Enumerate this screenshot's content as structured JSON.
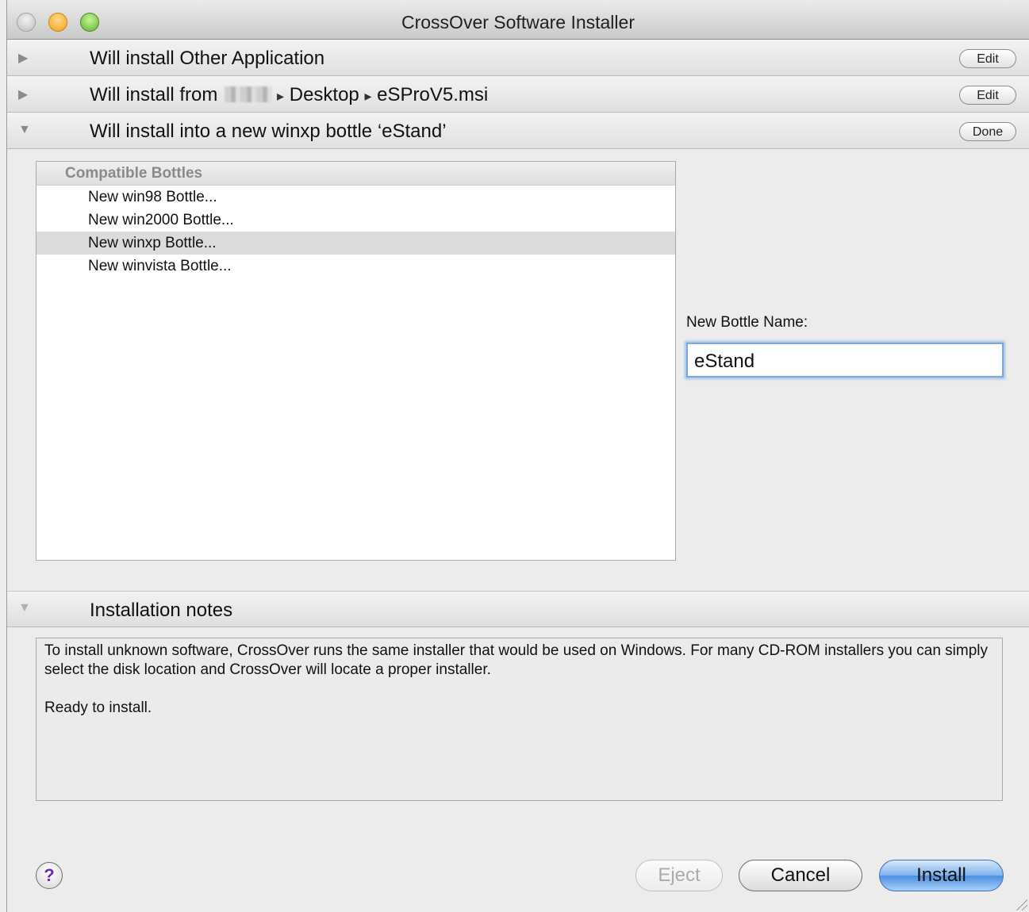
{
  "window": {
    "title": "CrossOver Software Installer"
  },
  "sections": [
    {
      "label": "Will install Other Application",
      "button": "Edit",
      "expanded": false
    },
    {
      "label_prefix": "Will install from",
      "path": [
        "Desktop",
        "eSProV5.msi"
      ],
      "path_separator": "▸",
      "button": "Edit",
      "expanded": false
    },
    {
      "label": "Will install into a new winxp bottle ‘eStand’",
      "button": "Done",
      "expanded": true
    }
  ],
  "bottles": {
    "header": "Compatible Bottles",
    "items": [
      "New win98 Bottle...",
      "New win2000 Bottle...",
      "New winxp Bottle...",
      "New winvista Bottle..."
    ],
    "selected": "New winxp Bottle..."
  },
  "new_bottle": {
    "label": "New Bottle Name:",
    "value": "eStand"
  },
  "notes": {
    "label": "Installation notes",
    "text": "To install unknown software, CrossOver runs the same installer that would be used on Windows. For many CD-ROM installers you can simply select the disk location and CrossOver will locate a proper installer.",
    "status": "Ready to install."
  },
  "footer": {
    "help": "?",
    "eject": "Eject",
    "cancel": "Cancel",
    "install": "Install"
  },
  "colors": {
    "install_button": "#6ea8ea",
    "selection": "#dcdcdc",
    "focus_ring": "#7fa8da"
  }
}
